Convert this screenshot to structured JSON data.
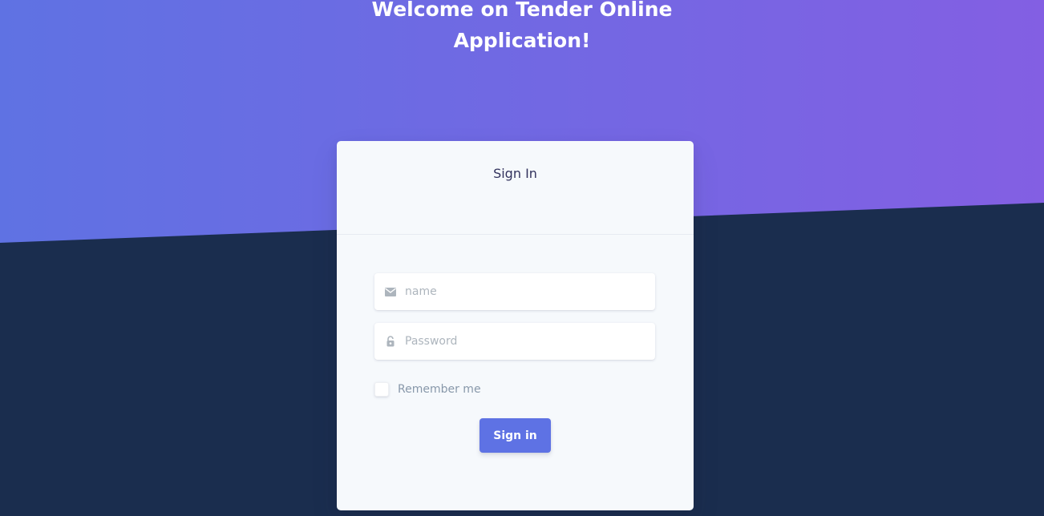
{
  "hero": {
    "title_line1": "Welcome on Tender Online",
    "title_line2": "Application!",
    "gradient_start": "#5e72e4",
    "gradient_end": "#825ee4",
    "lower_background": "#1a2d4e"
  },
  "login_card": {
    "title": "Sign In",
    "name_field": {
      "placeholder": "name",
      "value": "",
      "icon": "envelope-icon"
    },
    "password_field": {
      "placeholder": "Password",
      "value": "",
      "icon": "lock-icon"
    },
    "remember_label": "Remember me",
    "remember_checked": false,
    "submit_label": "Sign in",
    "accent_color": "#5e72e4"
  }
}
